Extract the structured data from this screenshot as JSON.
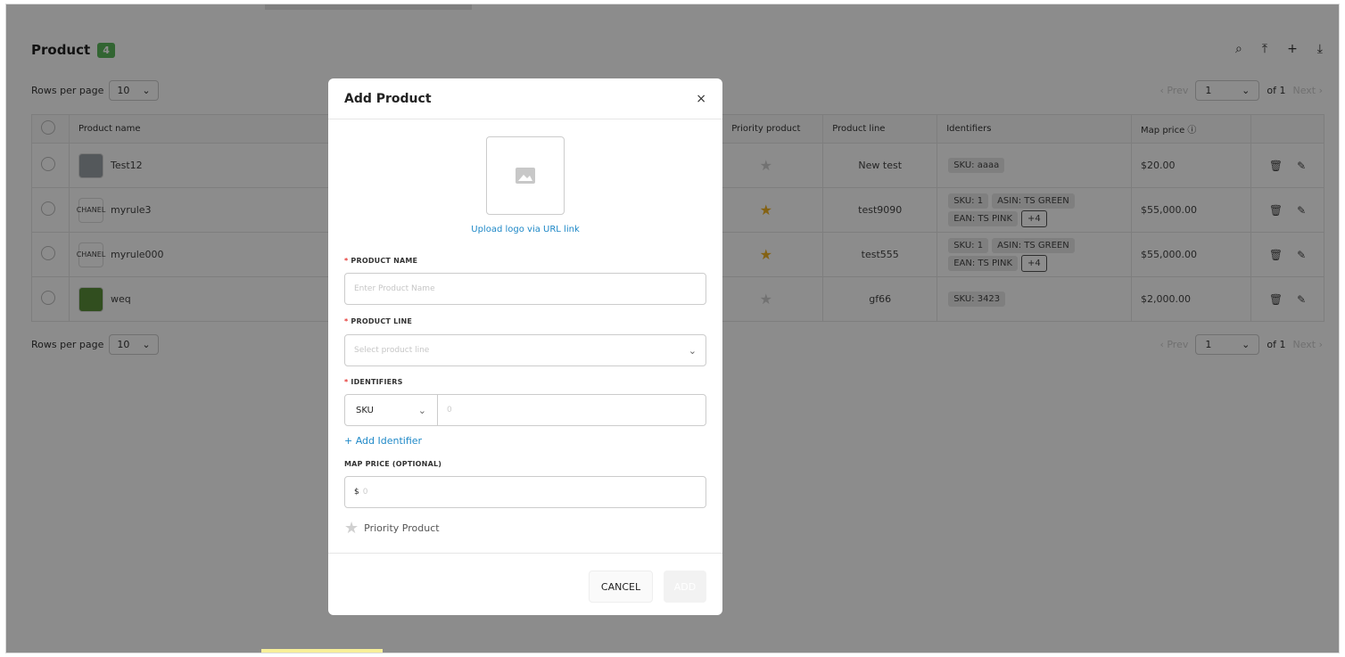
{
  "page": {
    "title": "Product",
    "count": "4",
    "toolbar": {
      "search_icon": "⌕",
      "upload_icon": "⤒",
      "add_icon": "+",
      "download_icon": "⤓"
    },
    "rows_label": "Rows per page",
    "rows_value": "10",
    "pager": {
      "prev": "‹ Prev",
      "page": "1",
      "of": "of 1",
      "next": "Next ›"
    },
    "columns": {
      "product_name": "Product name",
      "priority": "Priority product",
      "line": "Product line",
      "identifiers": "Identifiers",
      "map_price": "Map price ⓘ"
    },
    "rows": [
      {
        "name": "Test12",
        "thumb": "img",
        "line": "New test",
        "chips": [
          "SKU: aaaa"
        ],
        "more": "",
        "price": "$20.00",
        "priority": false
      },
      {
        "name": "myrule3",
        "thumb": "CHANEL",
        "line": "test9090",
        "chips": [
          "SKU: 1",
          "ASIN: TS GREEN",
          "EAN: TS PINK"
        ],
        "more": "+4",
        "price": "$55,000.00",
        "priority": true
      },
      {
        "name": "myrule000",
        "thumb": "CHANEL",
        "line": "test555",
        "chips": [
          "SKU: 1",
          "ASIN: TS GREEN",
          "EAN: TS PINK"
        ],
        "more": "+4",
        "price": "$55,000.00",
        "priority": true
      },
      {
        "name": "weq",
        "thumb": "img",
        "line": "gf66",
        "chips": [
          "SKU: 3423"
        ],
        "more": "",
        "price": "$2,000.00",
        "priority": false
      }
    ]
  },
  "modal": {
    "title": "Add Product",
    "close": "×",
    "upload_link": "Upload logo via URL link",
    "product_name_label": "PRODUCT NAME",
    "product_name_placeholder": "Enter Product Name",
    "product_line_label": "PRODUCT LINE",
    "product_line_placeholder": "Select product line",
    "identifiers_label": "IDENTIFIERS",
    "identifier_type": "SKU",
    "identifier_value_placeholder": "0",
    "add_identifier": "+ Add Identifier",
    "map_price_label": "MAP PRICE (OPTIONAL)",
    "currency": "$",
    "map_price_placeholder": "0",
    "priority_label": "Priority Product",
    "cancel": "CANCEL",
    "add": "ADD"
  },
  "colors": {
    "accent": "#1e88c7",
    "badge": "#5cb85c",
    "star_on": "#f0b323",
    "required": "#e53935"
  }
}
